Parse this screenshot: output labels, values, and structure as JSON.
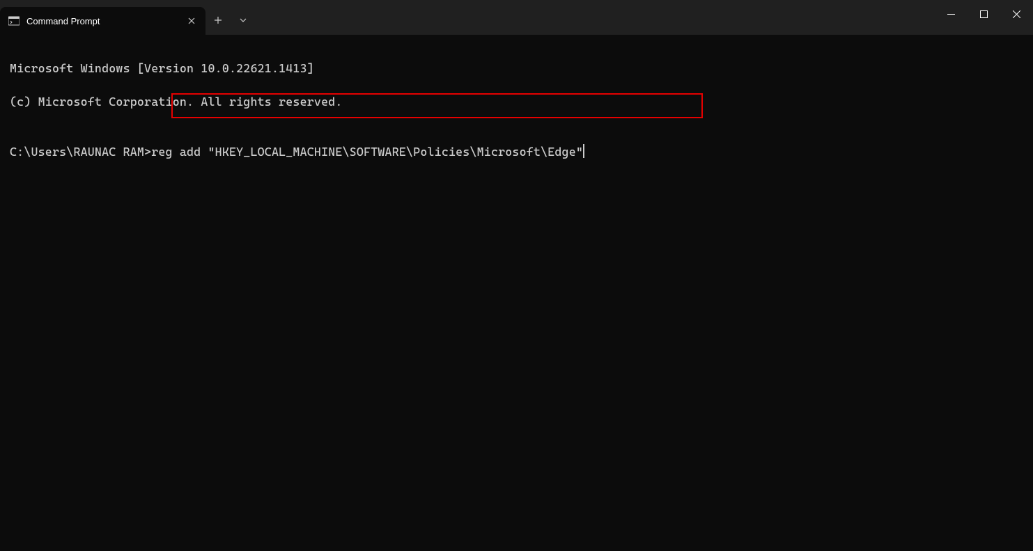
{
  "tab": {
    "title": "Command Prompt"
  },
  "terminal": {
    "line1": "Microsoft Windows [Version 10.0.22621.1413]",
    "line2": "(c) Microsoft Corporation. All rights reserved.",
    "blank": "",
    "prompt": "C:\\Users\\RAUNAC RAM>",
    "command": "reg add \"HKEY_LOCAL_MACHINE\\SOFTWARE\\Policies\\Microsoft\\Edge\""
  }
}
